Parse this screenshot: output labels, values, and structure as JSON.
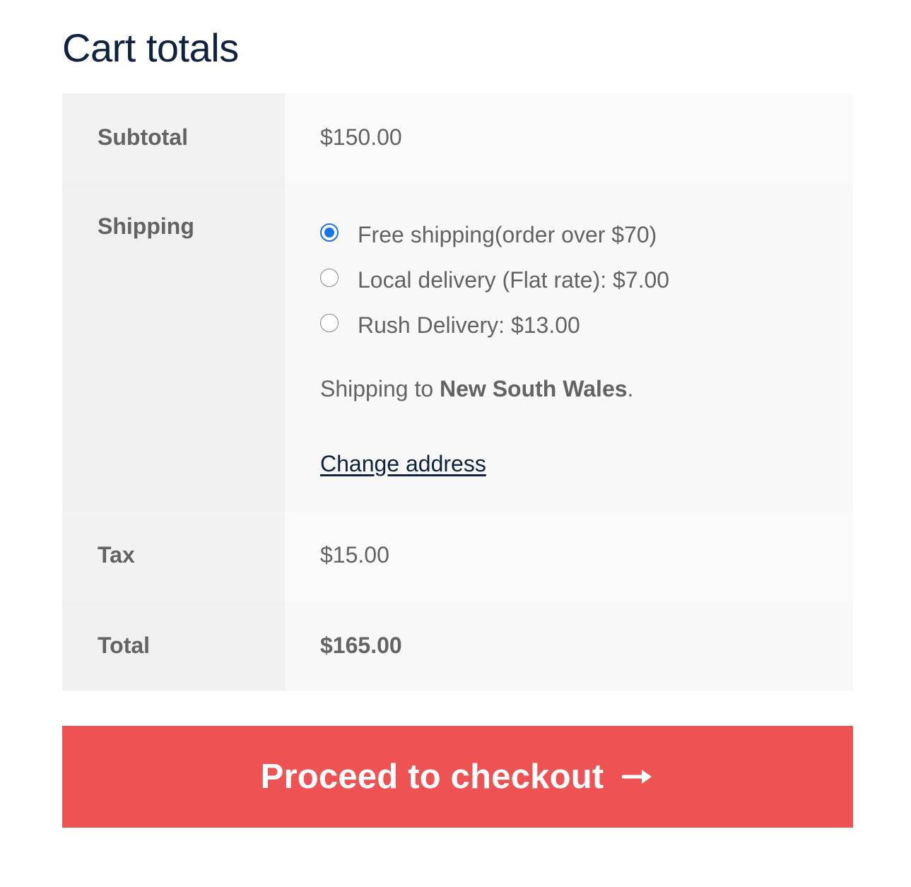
{
  "page": {
    "title": "Cart totals"
  },
  "totals": {
    "subtotal": {
      "label": "Subtotal",
      "value": "$150.00"
    },
    "shipping": {
      "label": "Shipping",
      "methods": [
        {
          "label": "Free shipping(order over $70)",
          "selected": true
        },
        {
          "label": "Local delivery (Flat rate): $7.00",
          "selected": false
        },
        {
          "label": "Rush Delivery: $13.00",
          "selected": false
        }
      ],
      "destination_prefix": "Shipping to ",
      "destination": "New South Wales",
      "destination_suffix": ".",
      "change_address_label": "Change address"
    },
    "tax": {
      "label": "Tax",
      "value": "$15.00"
    },
    "total": {
      "label": "Total",
      "value": "$165.00"
    }
  },
  "checkout": {
    "label": "Proceed to checkout",
    "icon": "arrow-right-icon",
    "color": "#ee5253"
  },
  "colors": {
    "heading": "#0f2341",
    "text": "#636363",
    "radio_accent": "#1a73e8"
  }
}
